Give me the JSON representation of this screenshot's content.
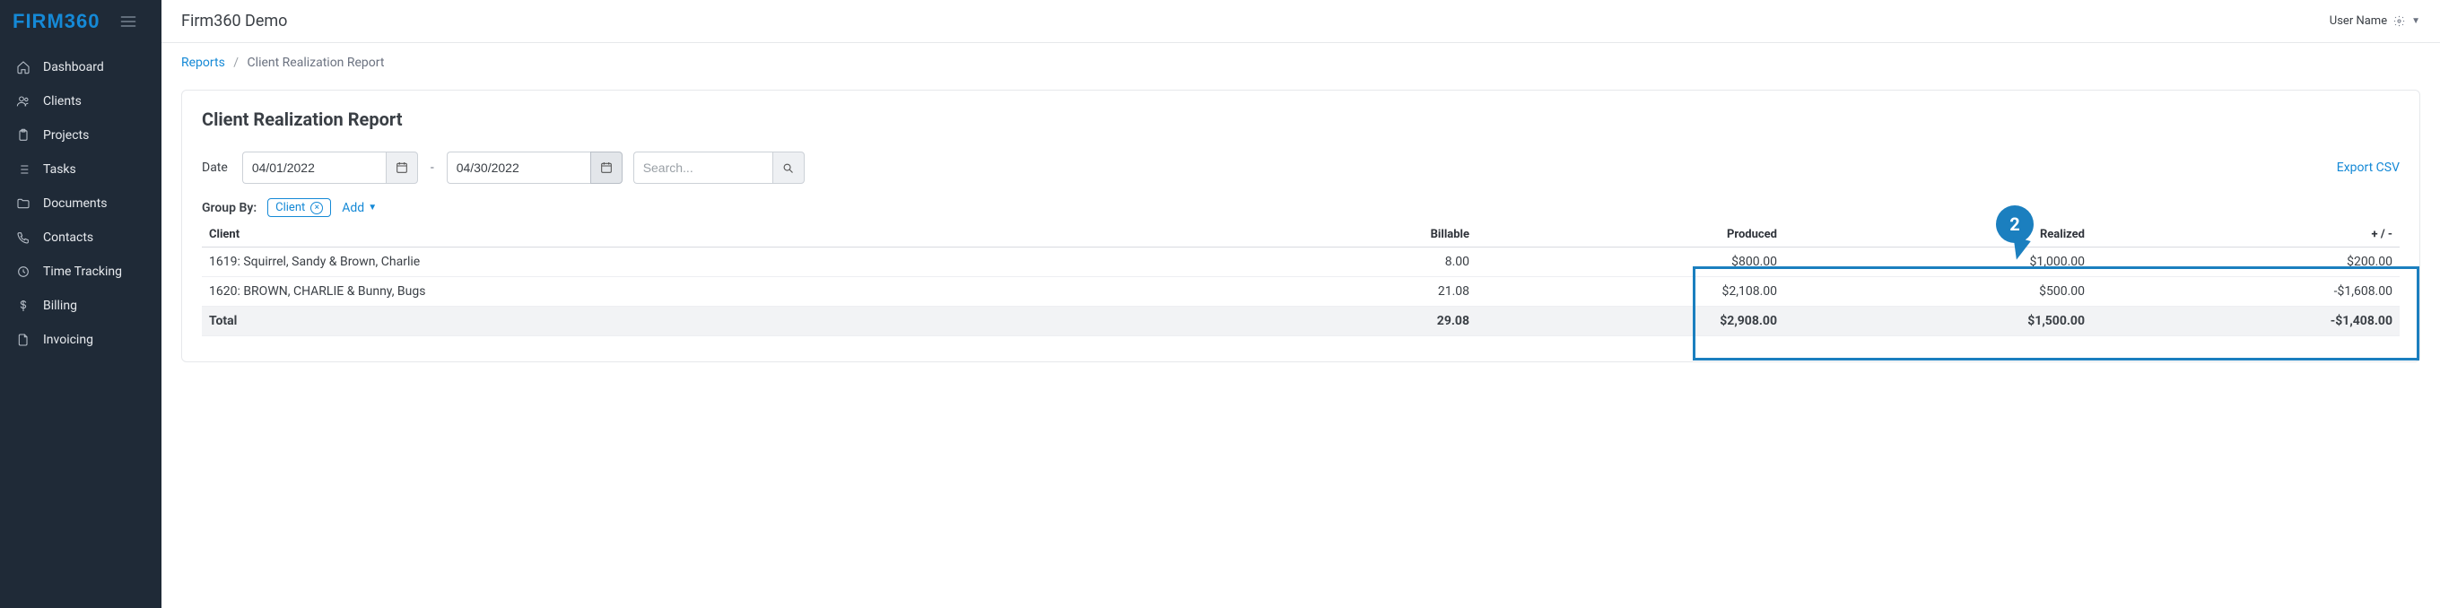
{
  "brand": "FIRM360",
  "topbar": {
    "title": "Firm360 Demo",
    "user": "User Name"
  },
  "sidebar": {
    "items": [
      {
        "label": "Dashboard",
        "icon": "home-icon"
      },
      {
        "label": "Clients",
        "icon": "users-icon"
      },
      {
        "label": "Projects",
        "icon": "clipboard-icon"
      },
      {
        "label": "Tasks",
        "icon": "list-icon"
      },
      {
        "label": "Documents",
        "icon": "folder-icon"
      },
      {
        "label": "Contacts",
        "icon": "phone-icon"
      },
      {
        "label": "Time Tracking",
        "icon": "clock-icon"
      },
      {
        "label": "Billing",
        "icon": "dollar-icon"
      },
      {
        "label": "Invoicing",
        "icon": "file-icon"
      }
    ]
  },
  "breadcrumb": {
    "root": "Reports",
    "current": "Client Realization Report"
  },
  "panel": {
    "title": "Client Realization Report",
    "date_label": "Date",
    "date_from": "04/01/2022",
    "date_to": "04/30/2022",
    "search_placeholder": "Search...",
    "export_label": "Export CSV",
    "groupby_label": "Group By:",
    "groupby_chip": "Client",
    "add_label": "Add",
    "annotation_number": "2",
    "columns": {
      "client": "Client",
      "billable": "Billable",
      "produced": "Produced",
      "realized": "Realized",
      "delta": "+ / -"
    },
    "rows": [
      {
        "client": "1619: Squirrel, Sandy & Brown, Charlie",
        "billable": "8.00",
        "produced": "$800.00",
        "realized": "$1,000.00",
        "delta": "$200.00",
        "sign": "pos"
      },
      {
        "client": "1620: BROWN, CHARLIE & Bunny, Bugs",
        "billable": "21.08",
        "produced": "$2,108.00",
        "realized": "$500.00",
        "delta": "-$1,608.00",
        "sign": "neg"
      }
    ],
    "total": {
      "label": "Total",
      "billable": "29.08",
      "produced": "$2,908.00",
      "realized": "$1,500.00",
      "delta": "-$1,408.00",
      "sign": "neg"
    }
  }
}
